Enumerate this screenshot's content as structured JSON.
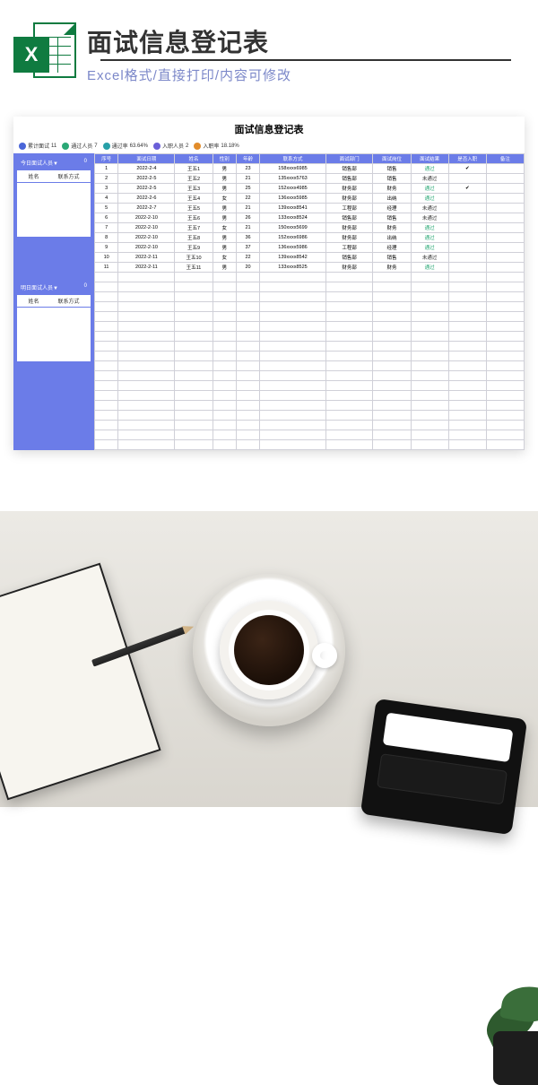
{
  "banner": {
    "title": "面试信息登记表",
    "subtitle": "Excel格式/直接打印/内容可修改",
    "icon_letter": "X"
  },
  "sheet": {
    "title": "面试信息登记表",
    "stats": {
      "total_label": "累计面试",
      "total_value": "11",
      "pass_count_label": "通过人员",
      "pass_count_value": "7",
      "pass_rate_label": "通过率",
      "pass_rate_value": "63.64%",
      "join_count_label": "入职人员",
      "join_count_value": "2",
      "join_rate_label": "入职率",
      "join_rate_value": "18.18%"
    },
    "side": {
      "today_label": "今日面试人员▼",
      "today_count": "0",
      "tomorrow_label": "明日面试人员▼",
      "tomorrow_count": "0",
      "col_name": "姓名",
      "col_phone": "联系方式"
    },
    "columns": {
      "seq": "序号",
      "date": "面试日期",
      "name": "姓名",
      "sex": "性别",
      "age": "年龄",
      "phone": "联系方式",
      "dept": "面试部门",
      "pos": "面试岗位",
      "result": "面试结果",
      "joined": "是否入职",
      "note": "备注"
    },
    "rows": [
      {
        "seq": "1",
        "date": "2022-2-4",
        "name": "王五1",
        "sex": "男",
        "age": "23",
        "phone": "158xxxx6985",
        "dept": "销售部",
        "pos": "销售",
        "result": "通过",
        "joined": "✔",
        "note": ""
      },
      {
        "seq": "2",
        "date": "2022-2-5",
        "name": "王五2",
        "sex": "男",
        "age": "21",
        "phone": "135xxxx5763",
        "dept": "销售部",
        "pos": "销售",
        "result": "未通过",
        "joined": "",
        "note": ""
      },
      {
        "seq": "3",
        "date": "2022-2-5",
        "name": "王五3",
        "sex": "男",
        "age": "25",
        "phone": "152xxxx4985",
        "dept": "财务部",
        "pos": "财务",
        "result": "通过",
        "joined": "✔",
        "note": ""
      },
      {
        "seq": "4",
        "date": "2022-2-6",
        "name": "王五4",
        "sex": "女",
        "age": "22",
        "phone": "136xxxx5985",
        "dept": "财务部",
        "pos": "出纳",
        "result": "通过",
        "joined": "",
        "note": ""
      },
      {
        "seq": "5",
        "date": "2022-2-7",
        "name": "王五5",
        "sex": "男",
        "age": "21",
        "phone": "139xxxx8541",
        "dept": "工程部",
        "pos": "经理",
        "result": "未通过",
        "joined": "",
        "note": ""
      },
      {
        "seq": "6",
        "date": "2022-2-10",
        "name": "王五6",
        "sex": "男",
        "age": "26",
        "phone": "133xxxx8524",
        "dept": "销售部",
        "pos": "销售",
        "result": "未通过",
        "joined": "",
        "note": ""
      },
      {
        "seq": "7",
        "date": "2022-2-10",
        "name": "王五7",
        "sex": "女",
        "age": "21",
        "phone": "150xxxx5699",
        "dept": "财务部",
        "pos": "财务",
        "result": "通过",
        "joined": "",
        "note": ""
      },
      {
        "seq": "8",
        "date": "2022-2-10",
        "name": "王五8",
        "sex": "男",
        "age": "36",
        "phone": "152xxxx6986",
        "dept": "财务部",
        "pos": "出纳",
        "result": "通过",
        "joined": "",
        "note": ""
      },
      {
        "seq": "9",
        "date": "2022-2-10",
        "name": "王五9",
        "sex": "男",
        "age": "37",
        "phone": "136xxxx5986",
        "dept": "工程部",
        "pos": "经理",
        "result": "通过",
        "joined": "",
        "note": ""
      },
      {
        "seq": "10",
        "date": "2022-2-11",
        "name": "王五10",
        "sex": "女",
        "age": "22",
        "phone": "139xxxx8542",
        "dept": "销售部",
        "pos": "销售",
        "result": "未通过",
        "joined": "",
        "note": ""
      },
      {
        "seq": "11",
        "date": "2022-2-11",
        "name": "王五11",
        "sex": "男",
        "age": "20",
        "phone": "133xxxx8525",
        "dept": "财务部",
        "pos": "财务",
        "result": "通过",
        "joined": "",
        "note": ""
      }
    ],
    "empty_rows": 18
  }
}
